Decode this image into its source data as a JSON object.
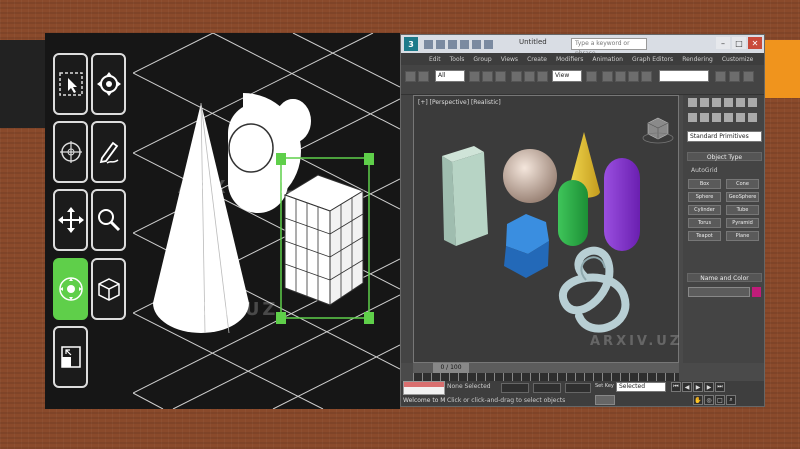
{
  "watermark": "ARXIV.UZ",
  "tools": [
    {
      "name": "select-object",
      "active": false
    },
    {
      "name": "select-and-rotate",
      "active": false
    },
    {
      "name": "transform-gizmo",
      "active": false
    },
    {
      "name": "freeform-paint",
      "active": false
    },
    {
      "name": "select-and-move",
      "active": false
    },
    {
      "name": "zoom",
      "active": false
    },
    {
      "name": "orbit",
      "active": true
    },
    {
      "name": "viewcube",
      "active": false
    },
    {
      "name": "maximize-viewport",
      "active": false
    }
  ],
  "max_window": {
    "logo": "3",
    "title": "Untitled",
    "search_placeholder": "Type a keyword or phrase",
    "menu": [
      "Edit",
      "Tools",
      "Group",
      "Views",
      "Create",
      "Modifiers",
      "Animation",
      "Graph Editors",
      "Rendering",
      "Customize"
    ],
    "toolbar_combo_all": "All",
    "toolbar_combo_view": "View",
    "viewport_label": "[+] [Perspective] [Realistic]",
    "command_panel": {
      "category": "Standard Primitives",
      "object_type_title": "Object Type",
      "autogrid": "AutoGrid",
      "buttons": [
        "Box",
        "Cone",
        "Sphere",
        "GeoSphere",
        "Cylinder",
        "Tube",
        "Torus",
        "Pyramid",
        "Teapot",
        "Plane"
      ],
      "name_color_title": "Name and Color"
    },
    "timeslider": "0 / 100",
    "status": {
      "selection": "None Selected",
      "hint": "Click or click-and-drag to select objects",
      "welcome": "Welcome to M",
      "key_filter_label": "Selected",
      "set_key_label": "Set Key"
    },
    "colors": {
      "accent_green": "#5fcf4a",
      "brand_orange": "#f0941d",
      "swatch_magenta": "#c01c7a"
    }
  }
}
